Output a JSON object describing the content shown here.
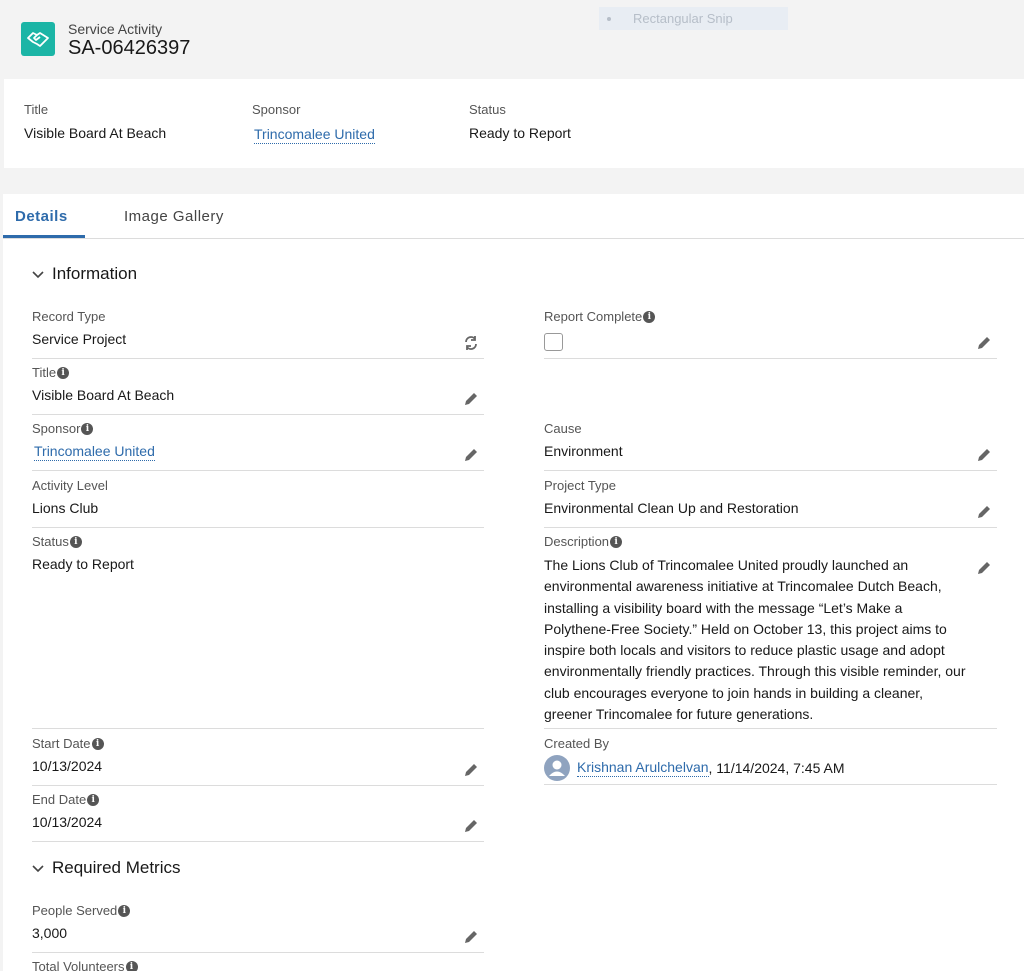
{
  "header": {
    "object_label": "Service Activity",
    "record_name": "SA-06426397",
    "overlay_text": "Rectangular Snip"
  },
  "highlights": [
    {
      "label": "Title",
      "value": "Visible Board At Beach"
    },
    {
      "label": "Sponsor",
      "value": "Trincomalee United"
    },
    {
      "label": "Status",
      "value": "Ready to Report"
    }
  ],
  "tabs": [
    {
      "label": "Details",
      "active": true
    },
    {
      "label": "Image Gallery",
      "active": false
    }
  ],
  "sections": {
    "information": "Information",
    "metrics": "Required Metrics"
  },
  "fields": {
    "record_type": {
      "label": "Record Type",
      "value": "Service Project"
    },
    "report_complete": {
      "label": "Report Complete",
      "checked": false
    },
    "title": {
      "label": "Title",
      "value": "Visible Board At Beach"
    },
    "sponsor": {
      "label": "Sponsor",
      "value": "Trincomalee United"
    },
    "cause": {
      "label": "Cause",
      "value": "Environment"
    },
    "activity_level": {
      "label": "Activity Level",
      "value": "Lions Club"
    },
    "project_type": {
      "label": "Project Type",
      "value": "Environmental Clean Up and Restoration"
    },
    "status": {
      "label": "Status",
      "value": "Ready to Report"
    },
    "description": {
      "label": "Description",
      "value": "The Lions Club of Trincomalee United proudly launched an environmental awareness initiative at Trincomalee Dutch Beach, installing a visibility board with the message “Let’s Make a Polythene-Free Society.” Held on October 13, this project aims to inspire both locals and visitors to reduce plastic usage and adopt environmentally friendly practices. Through this visible reminder, our club encourages everyone to join hands in building a cleaner, greener Trincomalee for future generations."
    },
    "start_date": {
      "label": "Start Date",
      "value": "10/13/2024"
    },
    "created_by": {
      "label": "Created By",
      "user": "Krishnan Arulchelvan",
      "datetime": ", 11/14/2024, 7:45 AM"
    },
    "end_date": {
      "label": "End Date",
      "value": "10/13/2024"
    },
    "people_served": {
      "label": "People Served",
      "value": "3,000"
    },
    "total_volunteers": {
      "label": "Total Volunteers"
    }
  },
  "colors": {
    "accent": "#2e6bab",
    "app_icon": "#1bb5a6"
  },
  "icons": {
    "app": "handshake-icon",
    "edit": "pencil-icon",
    "change_type": "change-record-type-icon",
    "info": "info-icon",
    "chevron": "chevron-down-icon"
  }
}
